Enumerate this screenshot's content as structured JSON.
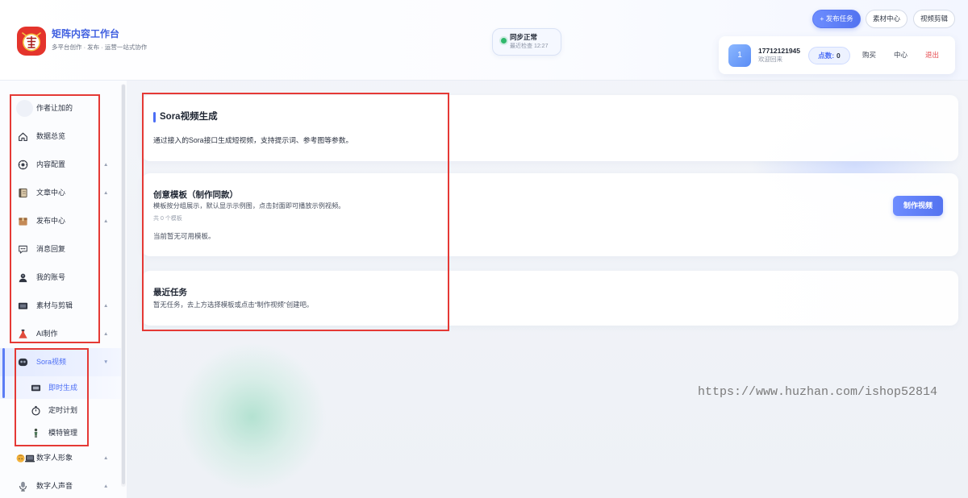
{
  "app": {
    "title": "矩阵内容工作台",
    "subtitle": "多平台创作 · 发布 · 运营一站式协作",
    "accent_color": "#4c6ef5"
  },
  "status": {
    "label": "同步正常",
    "detail": "最近检查 12:27",
    "dot_color": "#2fb86b"
  },
  "toolbar": {
    "publish_label": "+ 发布任务",
    "materials_label": "素材中心",
    "video_edit_label": "视频剪辑"
  },
  "user": {
    "avatar_text": "1",
    "phone": "17712121945",
    "greeting": "欢迎回来",
    "points_label": "点数:",
    "points_value": "0",
    "buy_label": "购买",
    "center_label": "中心",
    "logout_label": "退出",
    "logout_color": "#e5484d"
  },
  "sidebar": {
    "items": [
      {
        "label": "作者让加的",
        "icon": "blank-circle-icon",
        "arrow": ""
      },
      {
        "label": "数据总览",
        "icon": "house-icon",
        "arrow": ""
      },
      {
        "label": "内容配置",
        "icon": "settings-icon",
        "arrow": "▲"
      },
      {
        "label": "文章中心",
        "icon": "notebook-icon",
        "arrow": "▲"
      },
      {
        "label": "发布中心",
        "icon": "package-icon",
        "arrow": "▲"
      },
      {
        "label": "消息回复",
        "icon": "chat-bubble-icon",
        "arrow": ""
      },
      {
        "label": "我的账号",
        "icon": "user-silhouette-icon",
        "arrow": ""
      },
      {
        "label": "素材与剪辑",
        "icon": "film-icon",
        "arrow": "▲"
      },
      {
        "label": "AI制作",
        "icon": "flask-icon",
        "arrow": "▲"
      },
      {
        "label": "Sora视频",
        "icon": "video-camera-icon",
        "arrow": "▼",
        "active": true,
        "children": [
          {
            "label": "即时生成",
            "icon": "film-frame-icon",
            "active": true
          },
          {
            "label": "定时计划",
            "icon": "stopwatch-icon",
            "active": false
          },
          {
            "label": "模特管理",
            "icon": "model-figure-icon",
            "active": false
          }
        ]
      },
      {
        "label": "数字人形象",
        "icon": "avatar-laptop-icon",
        "arrow": "▲"
      },
      {
        "label": "数字人声音",
        "icon": "microphone-icon",
        "arrow": "▲"
      }
    ]
  },
  "main": {
    "intro": {
      "title": "Sora视频生成",
      "description": "通过接入的Sora接口生成短视频，支持提示词、参考图等参数。"
    },
    "templates": {
      "title": "创意模板（制作同款）",
      "description": "模板按分组展示，默认显示示例图，点击封面即可播放示例视频。",
      "count": "共 0 个模板",
      "empty": "当前暂无可用模板。",
      "action_label": "制作视频"
    },
    "recent": {
      "title": "最近任务",
      "empty": "暂无任务，去上方选择模板或点击“制作视频”创建吧。"
    }
  },
  "watermark": "https://www.huzhan.com/ishop52814",
  "annotation_color": "#e53935"
}
